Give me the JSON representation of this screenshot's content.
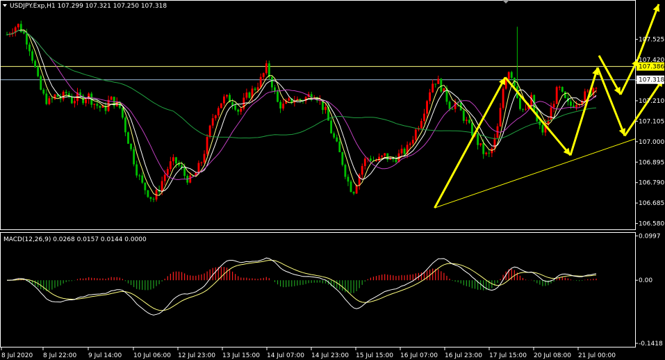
{
  "main_header": {
    "title_line": "USDJPY.Exp,H1  107.299 107.321 107.250 107.318"
  },
  "macd_header": {
    "title_line": "MACD(12,26,9) 0.0268 0.0157 0.0144 0.0000"
  },
  "colors": {
    "background": "#000000",
    "bull_candle": "#ff0000",
    "bear_candle": "#00c000",
    "fast_ma": "#ffff80",
    "mid_ma": "#ffffff",
    "slow_ma": "#c040c0",
    "long_ma": "#20a040",
    "arrows": "#ffff00",
    "trendline": "#ffff00",
    "level_line_upper": "#ffff80",
    "level_line_current": "#a0c0e0",
    "macd_pos": "#ff2020",
    "macd_neg": "#20a020",
    "macd_line": "#ffffff",
    "signal_line": "#ffff80"
  },
  "chart_data": [
    {
      "type": "candlestick",
      "symbol": "USDJPY.Exp",
      "timeframe": "H1",
      "ohlc_last": {
        "open": 107.299,
        "high": 107.321,
        "low": 107.25,
        "close": 107.318
      },
      "ylim": [
        106.55,
        107.72
      ],
      "y_ticks": [
        "107.525",
        "107.420",
        "107.315",
        "107.210",
        "107.105",
        "107.000",
        "106.895",
        "106.790",
        "106.685",
        "106.580"
      ],
      "price_labels": [
        {
          "value": 107.386,
          "text": "107.386",
          "style": "highlight"
        },
        {
          "value": 107.318,
          "text": "107.318",
          "style": "current"
        }
      ],
      "x_ticks": [
        "8 Jul 2020",
        "8 Jul 22:00",
        "9 Jul 14:00",
        "10 Jul 06:00",
        "12 Jul 23:00",
        "13 Jul 15:00",
        "14 Jul 07:00",
        "14 Jul 23:00",
        "15 Jul 15:00",
        "16 Jul 07:00",
        "16 Jul 23:00",
        "17 Jul 15:00",
        "20 Jul 08:00",
        "21 Jul 00:00"
      ],
      "close_path": [
        107.55,
        107.58,
        107.6,
        107.56,
        107.5,
        107.4,
        107.28,
        107.22,
        107.2,
        107.24,
        107.22,
        107.25,
        107.21,
        107.23,
        107.22,
        107.24,
        107.2,
        107.18,
        107.16,
        107.22,
        107.2,
        107.17,
        107.05,
        106.95,
        106.85,
        106.78,
        106.74,
        106.7,
        106.75,
        106.82,
        106.88,
        106.9,
        106.87,
        106.82,
        106.8,
        106.84,
        106.9,
        107.0,
        107.12,
        107.18,
        107.22,
        107.22,
        107.2,
        107.15,
        107.22,
        107.25,
        107.28,
        107.32,
        107.38,
        107.3,
        107.2,
        107.18,
        107.2,
        107.22,
        107.21,
        107.22,
        107.24,
        107.25,
        107.2,
        107.15,
        107.05,
        106.98,
        106.9,
        106.8,
        106.74,
        106.82,
        106.9,
        106.92,
        106.9,
        106.91,
        106.93,
        106.9,
        106.92,
        106.94,
        106.96,
        107.02,
        107.08,
        107.15,
        107.25,
        107.32,
        107.3,
        107.24,
        107.18,
        107.2,
        107.15,
        107.1,
        107.05,
        107.0,
        106.95,
        106.92,
        106.98,
        107.1,
        107.32,
        107.38,
        107.28,
        107.18,
        107.15,
        107.22,
        107.1,
        107.05,
        107.1,
        107.2,
        107.28,
        107.22,
        107.18,
        107.2,
        107.22,
        107.24,
        107.26,
        107.3
      ],
      "arrows": [
        {
          "from": [
            79,
            106.66
          ],
          "to": [
            92,
            107.33
          ]
        },
        {
          "from": [
            92,
            107.33
          ],
          "to": [
            104,
            106.93
          ]
        },
        {
          "from": [
            104,
            106.93
          ],
          "to": [
            109,
            107.38
          ]
        },
        {
          "from": [
            109,
            107.38
          ],
          "to": [
            114,
            107.03
          ]
        },
        {
          "from": [
            114,
            107.03
          ],
          "to": [
            121,
            107.32
          ]
        }
      ],
      "trendline": {
        "from": [
          79,
          106.66
        ],
        "to": [
          130,
          107.15
        ]
      }
    },
    {
      "type": "histogram+lines",
      "name": "MACD(12,26,9)",
      "values_last": {
        "macd": 0.0268,
        "signal": 0.0157,
        "histogram": 0.0144,
        "zero": 0.0
      },
      "ylim": [
        -0.148,
        0.105
      ],
      "y_ticks": [
        "0.0997",
        "0.00",
        "-0.1418"
      ]
    }
  ]
}
